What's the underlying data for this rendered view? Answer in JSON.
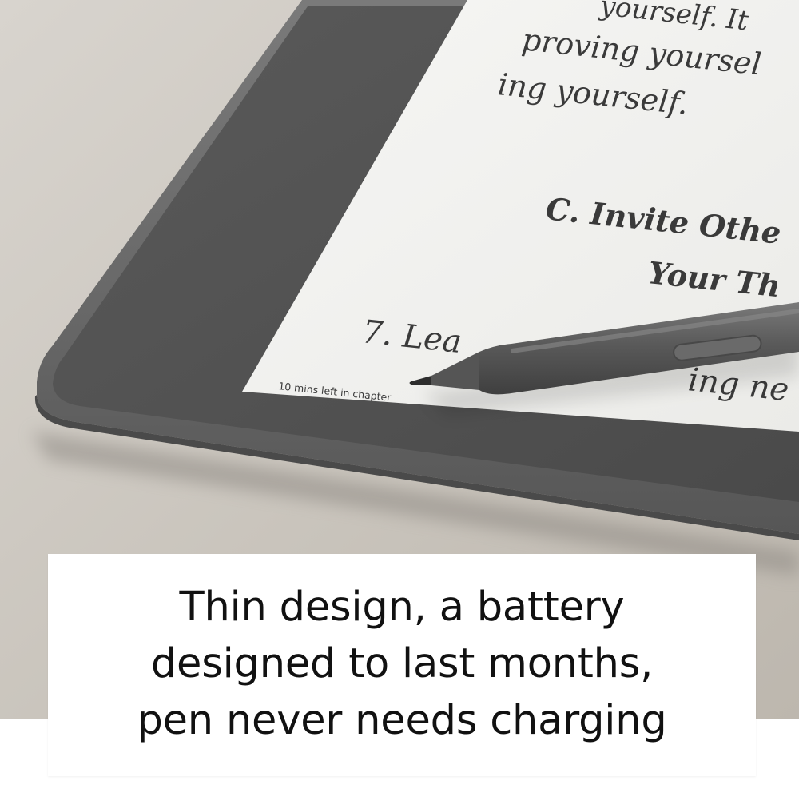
{
  "screen_text": {
    "line1": "yourself.  It",
    "line2": "proving yoursel",
    "line3": "ing yourself.",
    "heading1": "C. Invite Othe",
    "heading2": "Your Th",
    "line4": "7. Lea",
    "line4_tail": "ing ne",
    "status": "10 mins left in chapter"
  },
  "caption": {
    "line1": "Thin design, a battery",
    "line2": "designed to last months,",
    "line3": "pen never needs charging"
  },
  "colors": {
    "background": "#c9c4bd",
    "device_frame": "#616161",
    "bezel": "#4f4f4f",
    "screen": "#f3f3f1",
    "pen": "#5b5b5b",
    "text": "#3a3a3a"
  }
}
